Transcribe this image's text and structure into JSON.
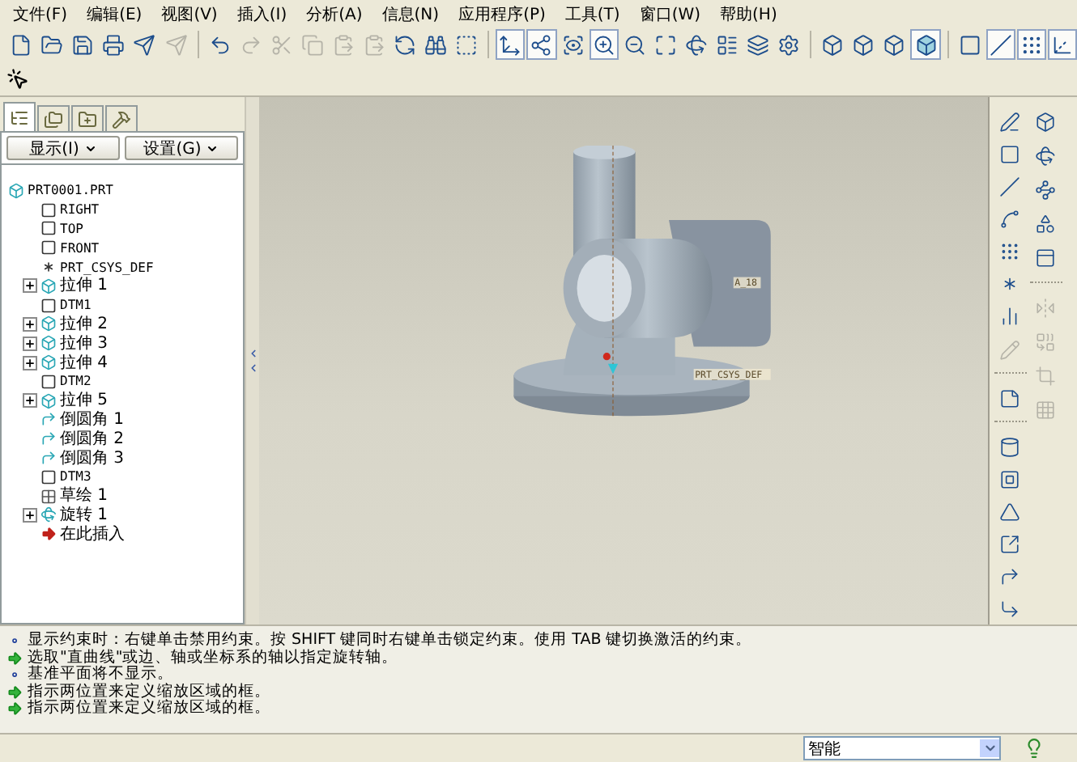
{
  "menu": [
    "文件(F)",
    "编辑(E)",
    "视图(V)",
    "插入(I)",
    "分析(A)",
    "信息(N)",
    "应用程序(P)",
    "工具(T)",
    "窗口(W)",
    "帮助(H)"
  ],
  "toolbar": [
    {
      "kind": "new",
      "pressed": false,
      "disabled": false
    },
    {
      "kind": "open",
      "pressed": false,
      "disabled": false
    },
    {
      "kind": "save",
      "pressed": false,
      "disabled": false
    },
    {
      "kind": "print",
      "pressed": false,
      "disabled": false
    },
    {
      "kind": "send",
      "pressed": false,
      "disabled": false
    },
    {
      "kind": "send",
      "pressed": false,
      "disabled": true
    },
    {
      "kind": "sep"
    },
    {
      "kind": "undo",
      "pressed": false,
      "disabled": false
    },
    {
      "kind": "redo",
      "pressed": false,
      "disabled": true
    },
    {
      "kind": "cut",
      "pressed": false,
      "disabled": true
    },
    {
      "kind": "copy",
      "pressed": false,
      "disabled": true
    },
    {
      "kind": "paste",
      "pressed": false,
      "disabled": true
    },
    {
      "kind": "paste",
      "pressed": false,
      "disabled": true
    },
    {
      "kind": "regenerate",
      "pressed": false,
      "disabled": false
    },
    {
      "kind": "find",
      "pressed": false,
      "disabled": false
    },
    {
      "kind": "select",
      "pressed": false,
      "disabled": false
    },
    {
      "kind": "sep"
    },
    {
      "kind": "orient",
      "pressed": true,
      "disabled": false
    },
    {
      "kind": "spin",
      "pressed": true,
      "disabled": false
    },
    {
      "kind": "views",
      "pressed": false,
      "disabled": false
    },
    {
      "kind": "zoom-in",
      "pressed": true,
      "disabled": false
    },
    {
      "kind": "zoom-out",
      "pressed": false,
      "disabled": false
    },
    {
      "kind": "refit",
      "pressed": false,
      "disabled": false
    },
    {
      "kind": "reorient",
      "pressed": false,
      "disabled": false
    },
    {
      "kind": "saved-views",
      "pressed": false,
      "disabled": false
    },
    {
      "kind": "layers",
      "pressed": false,
      "disabled": false
    },
    {
      "kind": "settings",
      "pressed": false,
      "disabled": false
    },
    {
      "kind": "sep"
    },
    {
      "kind": "wireframe",
      "pressed": false,
      "disabled": false
    },
    {
      "kind": "wireframe",
      "pressed": false,
      "disabled": false
    },
    {
      "kind": "wireframe",
      "pressed": false,
      "disabled": false
    },
    {
      "kind": "shaded",
      "pressed": true,
      "disabled": false
    },
    {
      "kind": "sep"
    },
    {
      "kind": "datum-plane",
      "pressed": false,
      "disabled": false
    },
    {
      "kind": "datum-axis",
      "pressed": true,
      "disabled": false
    },
    {
      "kind": "datum-point",
      "pressed": true,
      "disabled": false
    },
    {
      "kind": "csys",
      "pressed": true,
      "disabled": false
    }
  ],
  "panel": {
    "tabs": [
      {
        "kind": "tree",
        "selected": true
      },
      {
        "kind": "folder",
        "selected": false
      },
      {
        "kind": "favorites",
        "selected": false
      },
      {
        "kind": "connections",
        "selected": false
      }
    ],
    "buttons": [
      "显示(I)",
      "设置(G)"
    ],
    "tree": {
      "label": "PRT0001.PRT",
      "kind": "part",
      "children": [
        {
          "label": "RIGHT",
          "kind": "plane"
        },
        {
          "label": "TOP",
          "kind": "plane"
        },
        {
          "label": "FRONT",
          "kind": "plane"
        },
        {
          "label": "PRT_CSYS_DEF",
          "kind": "csys"
        },
        {
          "label": "拉伸 1",
          "kind": "extrude",
          "expanded": false
        },
        {
          "label": "DTM1",
          "kind": "plane"
        },
        {
          "label": "拉伸 2",
          "kind": "extrude",
          "expanded": false
        },
        {
          "label": "拉伸 3",
          "kind": "extrude",
          "expanded": false
        },
        {
          "label": "拉伸 4",
          "kind": "extrude",
          "expanded": false
        },
        {
          "label": "DTM2",
          "kind": "plane"
        },
        {
          "label": "拉伸 5",
          "kind": "extrude",
          "expanded": false
        },
        {
          "label": "倒圆角 1",
          "kind": "round"
        },
        {
          "label": "倒圆角 2",
          "kind": "round"
        },
        {
          "label": "倒圆角 3",
          "kind": "round"
        },
        {
          "label": "DTM3",
          "kind": "plane"
        },
        {
          "label": "草绘 1",
          "kind": "sketch"
        },
        {
          "label": "旋转 1",
          "kind": "revolve",
          "expanded": false
        },
        {
          "label": "在此插入",
          "kind": "insert"
        }
      ]
    }
  },
  "viewport": {
    "labels": [
      {
        "kind": "axis",
        "text": "A_18"
      },
      {
        "kind": "csys",
        "text": "PRT_CSYS_DEF"
      }
    ]
  },
  "right_toolbar": [
    [
      {
        "kind": "sketch",
        "disabled": false
      },
      {
        "kind": "plane",
        "disabled": false
      },
      {
        "kind": "axis",
        "disabled": false
      },
      {
        "kind": "curve",
        "disabled": false
      },
      {
        "kind": "point",
        "disabled": false
      },
      {
        "kind": "csys",
        "disabled": false
      },
      {
        "kind": "analysis",
        "disabled": false
      },
      {
        "kind": "reference",
        "disabled": true
      },
      {
        "kind": "sep"
      },
      {
        "kind": "note",
        "disabled": false
      },
      {
        "kind": "sep"
      },
      {
        "kind": "hole",
        "disabled": false
      },
      {
        "kind": "shell",
        "disabled": false
      },
      {
        "kind": "rib",
        "disabled": false
      },
      {
        "kind": "draft",
        "disabled": false
      },
      {
        "kind": "round",
        "disabled": false
      },
      {
        "kind": "chamfer",
        "disabled": false
      }
    ],
    [
      {
        "kind": "extrude",
        "disabled": false
      },
      {
        "kind": "revolve",
        "disabled": false
      },
      {
        "kind": "sweep",
        "disabled": false
      },
      {
        "kind": "blend",
        "disabled": false
      },
      {
        "kind": "boundary",
        "disabled": false
      },
      {
        "kind": "sep"
      },
      {
        "kind": "mirror",
        "disabled": true
      },
      {
        "kind": "merge",
        "disabled": true
      },
      {
        "kind": "trim",
        "disabled": true
      },
      {
        "kind": "pattern",
        "disabled": true
      }
    ]
  ],
  "messages": [
    {
      "kind": "info",
      "text": "显示约束时：右键单击禁用约束。按 SHIFT 键同时右键单击锁定约束。使用 TAB 键切换激活的约束。"
    },
    {
      "kind": "prompt",
      "text": "选取\"直曲线\"或边、轴或坐标系的轴以指定旋转轴。"
    },
    {
      "kind": "info",
      "text": "基准平面将不显示。"
    },
    {
      "kind": "prompt",
      "text": "指示两位置来定义缩放区域的框。"
    },
    {
      "kind": "prompt",
      "text": "指示两位置来定义缩放区域的框。"
    }
  ],
  "status_bar": {
    "filter": "智能"
  }
}
